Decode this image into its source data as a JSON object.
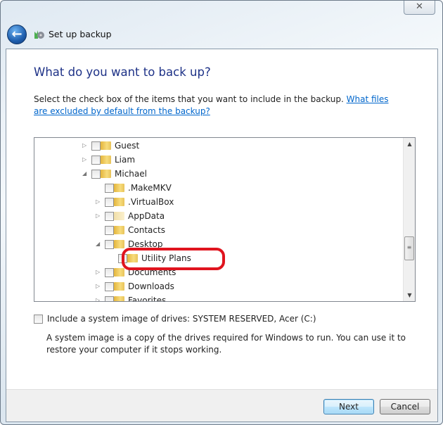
{
  "window": {
    "title": "Set up backup",
    "close_icon": "close-icon"
  },
  "main": {
    "heading": "What do you want to back up?",
    "instruction": "Select the check box of the items that you want to include in the backup. ",
    "help_link": "What files are excluded by default from the backup?"
  },
  "tree": {
    "items": [
      {
        "label": "Guest",
        "level": 0,
        "expander": "collapsed",
        "checked": false
      },
      {
        "label": "Liam",
        "level": 0,
        "expander": "collapsed",
        "checked": false
      },
      {
        "label": "Michael",
        "level": 0,
        "expander": "expanded",
        "checked": false
      },
      {
        "label": ".MakeMKV",
        "level": 1,
        "expander": "none",
        "checked": false
      },
      {
        "label": ".VirtualBox",
        "level": 1,
        "expander": "collapsed",
        "checked": false
      },
      {
        "label": "AppData",
        "level": 1,
        "expander": "collapsed",
        "checked": false
      },
      {
        "label": "Contacts",
        "level": 1,
        "expander": "none",
        "checked": false
      },
      {
        "label": "Desktop",
        "level": 1,
        "expander": "expanded",
        "checked": false
      },
      {
        "label": "Utility Plans",
        "level": 2,
        "expander": "none",
        "checked": false,
        "highlighted": true
      },
      {
        "label": "Documents",
        "level": 1,
        "expander": "collapsed",
        "checked": false
      },
      {
        "label": "Downloads",
        "level": 1,
        "expander": "collapsed",
        "checked": false
      },
      {
        "label": "Favorites",
        "level": 1,
        "expander": "collapsed",
        "checked": false
      }
    ],
    "highlight_color": "#e0141e"
  },
  "system_image": {
    "label": "Include a system image of drives: SYSTEM RESERVED, Acer (C:)",
    "checked": false,
    "description": "A system image is a copy of the drives required for Windows to run. You can use it to restore your computer if it stops working."
  },
  "footer": {
    "next_label": "Next",
    "cancel_label": "Cancel"
  }
}
